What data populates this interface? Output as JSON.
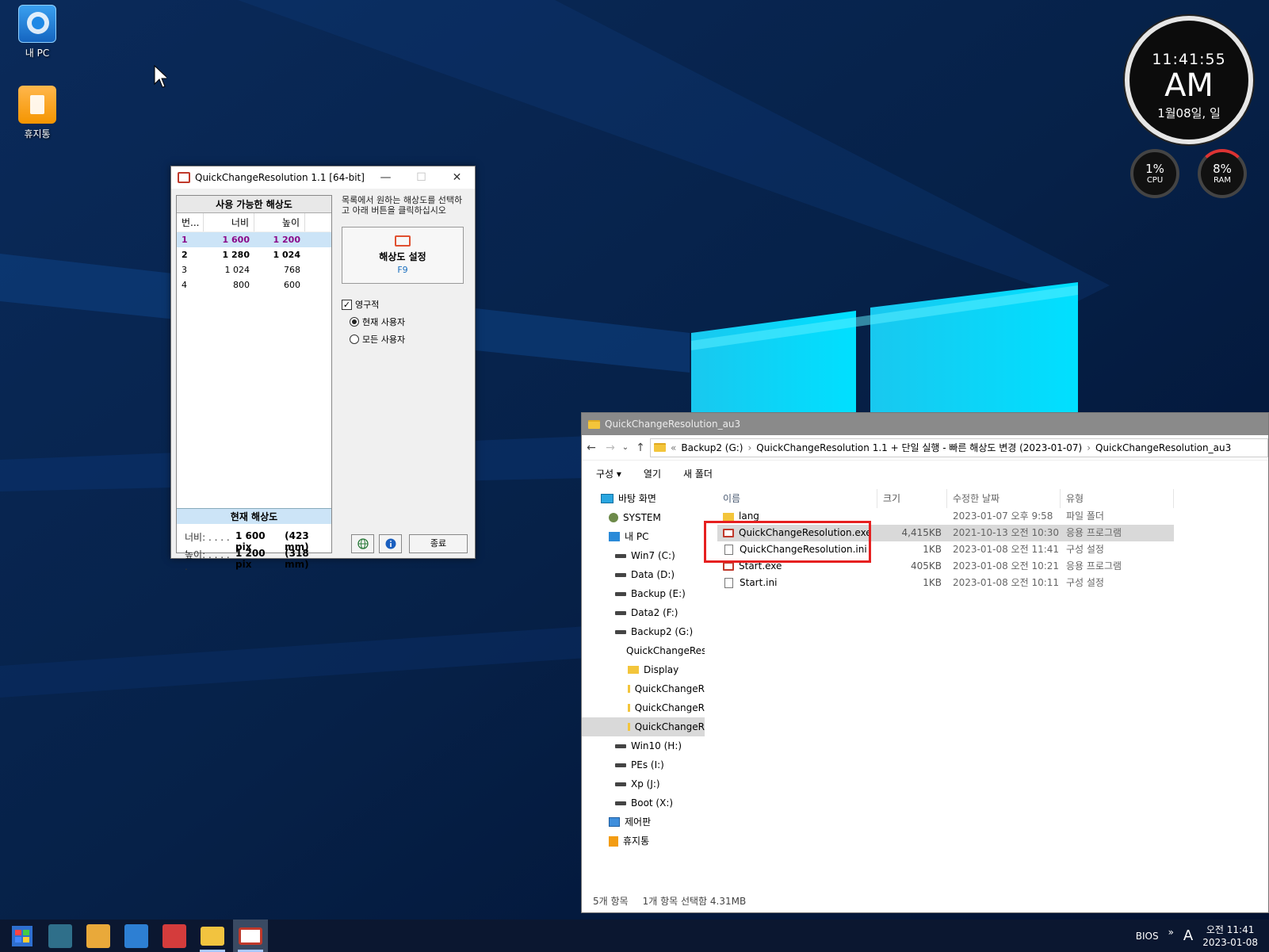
{
  "desktop": {
    "icons": [
      {
        "label": "내 PC",
        "icon": "computer-icon"
      },
      {
        "label": "휴지통",
        "icon": "recycle-bin-icon"
      }
    ]
  },
  "clock_gadget": {
    "time": "11:41:55",
    "ampm": "AM",
    "date": "1월08일,  일",
    "cpu": {
      "value": "1%",
      "label": "CPU"
    },
    "ram": {
      "value": "8%",
      "label": "RAM"
    }
  },
  "qcr": {
    "title": "QuickChangeResolution 1.1  [64-bit]",
    "list_header": "사용 가능한 해상도",
    "columns": [
      "번...",
      "너비",
      "높이"
    ],
    "rows": [
      {
        "no": "1",
        "width": "1 600",
        "height": "1 200"
      },
      {
        "no": "2",
        "width": "1 280",
        "height": "1 024"
      },
      {
        "no": "3",
        "width": "1 024",
        "height": "768"
      },
      {
        "no": "4",
        "width": "800",
        "height": "600"
      }
    ],
    "current_header": "현재 해상도",
    "current_width_label": "너비: . . . . .",
    "current_width_value": "1 600 pix",
    "current_width_mm": "(423 mm)",
    "current_height_label": "높이: . . . . .",
    "current_height_value": "1 200 pix",
    "current_height_mm": "(318 mm)",
    "instructions": "목록에서 원하는 해상도를 선택하고 아래 버튼을 클릭하십시오",
    "set_button_label": "해상도 설정",
    "set_button_key": "F9",
    "permanent_label": "영구적",
    "permanent_checked": true,
    "radio_current_user": "현재 사용자",
    "radio_all_users": "모든 사용자",
    "close_label": "종료"
  },
  "explorer": {
    "title": "QuickChangeResolution_au3",
    "breadcrumb": {
      "prefix": "«",
      "parts": [
        "Backup2 (G:)",
        "QuickChangeResolution 1.1 + 단일 실행 - 빠른 해상도 변경 (2023-01-07)",
        "QuickChangeResolution_au3"
      ]
    },
    "commands": [
      "구성 ▾",
      "열기",
      "새 폴더"
    ],
    "tree": [
      {
        "label": "바탕 화면",
        "icon": "desktop-icon",
        "indent": 1
      },
      {
        "label": "SYSTEM",
        "icon": "user-icon",
        "indent": 2
      },
      {
        "label": "내 PC",
        "icon": "pc-icon",
        "indent": 2
      },
      {
        "label": "Win7 (C:)",
        "icon": "drive-icon",
        "indent": 3
      },
      {
        "label": "Data (D:)",
        "icon": "drive-icon",
        "indent": 3
      },
      {
        "label": "Backup (E:)",
        "icon": "drive-icon",
        "indent": 3
      },
      {
        "label": "Data2 (F:)",
        "icon": "drive-icon",
        "indent": 3
      },
      {
        "label": "Backup2 (G:)",
        "icon": "drive-icon",
        "indent": 3
      },
      {
        "label": "QuickChangeRes",
        "icon": "folder-icon",
        "indent": 4
      },
      {
        "label": "Display",
        "icon": "folder-icon",
        "indent": 5
      },
      {
        "label": "QuickChangeR",
        "icon": "folder-icon",
        "indent": 5
      },
      {
        "label": "QuickChangeR",
        "icon": "folder-icon",
        "indent": 5
      },
      {
        "label": "QuickChangeR",
        "icon": "folder-icon",
        "indent": 5,
        "selected": true
      },
      {
        "label": "Win10 (H:)",
        "icon": "drive-icon",
        "indent": 3
      },
      {
        "label": "PEs (I:)",
        "icon": "drive-icon",
        "indent": 3
      },
      {
        "label": "Xp (J:)",
        "icon": "drive-icon",
        "indent": 3
      },
      {
        "label": "Boot (X:)",
        "icon": "drive-icon",
        "indent": 3
      },
      {
        "label": "제어판",
        "icon": "control-panel-icon",
        "indent": 2
      },
      {
        "label": "휴지통",
        "icon": "recycle-bin-icon",
        "indent": 2
      }
    ],
    "columns": [
      "이름",
      "크기",
      "수정한 날짜",
      "유형"
    ],
    "files": [
      {
        "name": "lang",
        "size": "",
        "date": "2023-01-07 오후 9:58",
        "type": "파일 폴더",
        "icon": "folder-icon"
      },
      {
        "name": "QuickChangeResolution.exe",
        "size": "4,415KB",
        "date": "2021-10-13 오전 10:30",
        "type": "응용 프로그램",
        "icon": "exe-icon",
        "selected": true
      },
      {
        "name": "QuickChangeResolution.ini",
        "size": "1KB",
        "date": "2023-01-08 오전 11:41",
        "type": "구성 설정",
        "icon": "ini-icon"
      },
      {
        "name": "Start.exe",
        "size": "405KB",
        "date": "2023-01-08 오전 10:21",
        "type": "응용 프로그램",
        "icon": "exe-icon"
      },
      {
        "name": "Start.ini",
        "size": "1KB",
        "date": "2023-01-08 오전 10:11",
        "type": "구성 설정",
        "icon": "ini-icon"
      }
    ],
    "status_count": "5개 항목",
    "status_selected": "1개 항목 선택함 4.31MB"
  },
  "taskbar": {
    "tray_bios": "BIOS",
    "tray_chevron": "»",
    "tray_ime": "A",
    "tray_time": "오전 11:41",
    "tray_date": "2023-01-08"
  },
  "colors": {
    "highlight": "#e62020",
    "selection": "#cce4f7",
    "accent": "#1a6fbf"
  }
}
